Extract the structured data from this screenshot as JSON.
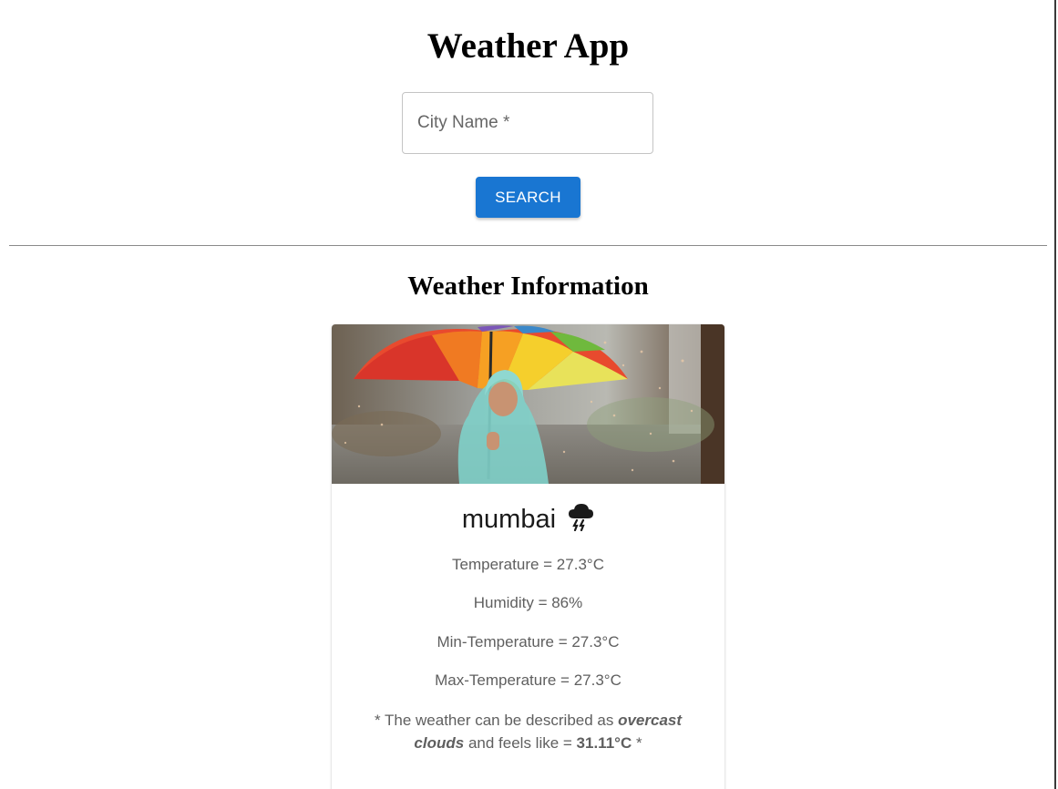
{
  "header": {
    "title": "Weather App"
  },
  "search": {
    "placeholder": "City Name *",
    "value": "",
    "button_label": "SEARCH"
  },
  "colors": {
    "primary": "#1976d2",
    "divider": "#8a8a8a",
    "body_text": "#5f5f5f"
  },
  "section": {
    "title": "Weather Information"
  },
  "card": {
    "image_icon": "rain-umbrella-photo",
    "city": "mumbai",
    "condition_icon": "thunderstorm-cloud-icon",
    "stats": [
      {
        "label": "Temperature = 27.3°C"
      },
      {
        "label": "Humidity = 86%"
      },
      {
        "label": "Min-Temperature = 27.3°C"
      },
      {
        "label": "Max-Temperature = 27.3°C"
      }
    ],
    "description": {
      "prefix": "* The weather can be described as ",
      "condition": "overcast clouds",
      "middle": " and feels like = ",
      "feels_like": "31.11°C",
      "suffix": " *"
    }
  }
}
